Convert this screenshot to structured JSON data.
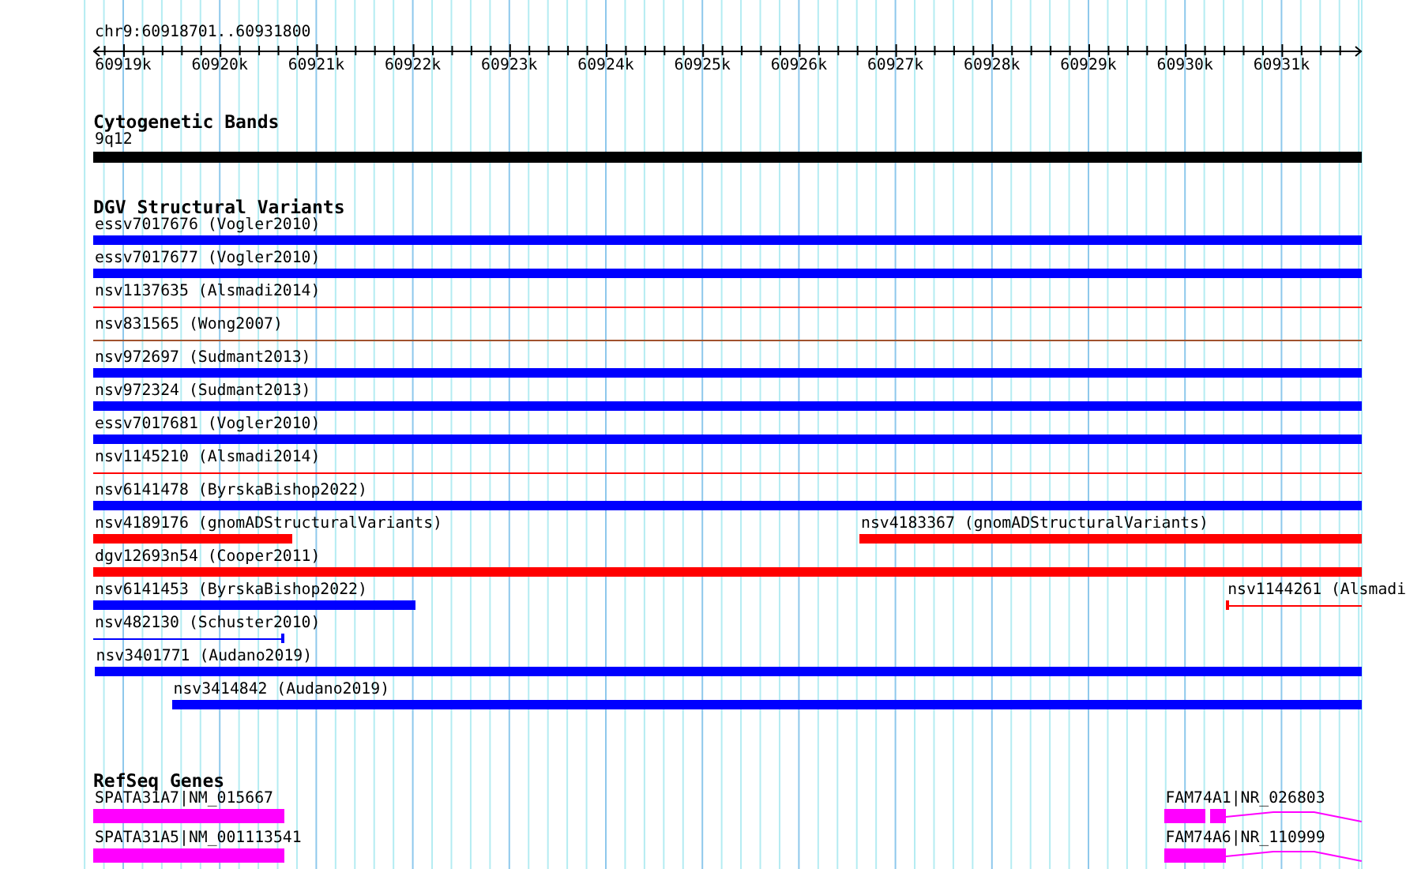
{
  "location": "chr9:60918701..60931800",
  "ruler": {
    "labels": [
      "60919k",
      "60920k",
      "60921k",
      "60922k",
      "60923k",
      "60924k",
      "60925k",
      "60926k",
      "60927k",
      "60928k",
      "60929k",
      "60930k",
      "60931k"
    ]
  },
  "tracks": [
    {
      "kind": "bands",
      "title": "Cytogenetic Bands",
      "rows": [
        {
          "features": [
            {
              "label": "9q12",
              "kind": "bar",
              "color": "#000000"
            }
          ]
        }
      ]
    },
    {
      "kind": "variants",
      "title": "DGV Structural Variants",
      "rows": [
        {
          "features": [
            {
              "label": "essv7017676 (Vogler2010)",
              "kind": "bar",
              "color": "#0000ff"
            }
          ]
        },
        {
          "features": [
            {
              "label": "essv7017677 (Vogler2010)",
              "kind": "bar",
              "color": "#0000ff"
            }
          ]
        },
        {
          "features": [
            {
              "label": "nsv1137635 (Alsmadi2014)",
              "kind": "line",
              "color": "#ff0000"
            }
          ]
        },
        {
          "features": [
            {
              "label": "nsv831565 (Wong2007)",
              "kind": "line",
              "color": "#a0522d"
            }
          ]
        },
        {
          "features": [
            {
              "label": "nsv972697 (Sudmant2013)",
              "kind": "bar",
              "color": "#0000ff"
            }
          ]
        },
        {
          "features": [
            {
              "label": "nsv972324 (Sudmant2013)",
              "kind": "bar",
              "color": "#0000ff"
            }
          ]
        },
        {
          "features": [
            {
              "label": "essv7017681 (Vogler2010)",
              "kind": "bar",
              "color": "#0000ff"
            }
          ]
        },
        {
          "features": [
            {
              "label": "nsv1145210 (Alsmadi2014)",
              "kind": "line",
              "color": "#ff0000"
            }
          ]
        },
        {
          "features": [
            {
              "label": "nsv6141478 (ByrskaBishop2022)",
              "kind": "bar",
              "color": "#0000ff"
            }
          ]
        },
        {
          "features": [
            {
              "label": "nsv4189176 (gnomADStructuralVariants)",
              "kind": "bar",
              "color": "#ff0000"
            },
            {
              "label": "nsv4183367 (gnomADStructuralVariants)",
              "kind": "bar",
              "color": "#ff0000"
            }
          ]
        },
        {
          "features": [
            {
              "label": "dgv12693n54 (Cooper2011)",
              "kind": "bar",
              "color": "#ff0000"
            }
          ]
        },
        {
          "features": [
            {
              "label": "nsv6141453 (ByrskaBishop2022)",
              "kind": "bar",
              "color": "#0000ff"
            },
            {
              "label": "nsv1144261 (Alsmadi",
              "kind": "line",
              "color": "#ff0000"
            }
          ]
        },
        {
          "features": [
            {
              "label": "nsv482130 (Schuster2010)",
              "kind": "line",
              "color": "#0000ff"
            }
          ]
        },
        {
          "features": [
            {
              "label": "nsv3401771 (Audano2019)",
              "kind": "bar",
              "color": "#0000ff"
            }
          ]
        },
        {
          "features": [
            {
              "label": "nsv3414842 (Audano2019)",
              "kind": "bar",
              "color": "#0000ff"
            }
          ]
        }
      ]
    },
    {
      "kind": "genes",
      "title": "RefSeq Genes",
      "rows": [
        {
          "features": [
            {
              "label": "SPATA31A7|NM_015667",
              "kind": "gene",
              "color": "#ff00ff"
            },
            {
              "label": "FAM74A1|NR_026803",
              "kind": "gene",
              "color": "#ff00ff"
            }
          ]
        },
        {
          "features": [
            {
              "label": "SPATA31A5|NM_001113541",
              "kind": "gene",
              "color": "#ff00ff"
            },
            {
              "label": "FAM74A6|NR_110999",
              "kind": "gene",
              "color": "#ff00ff"
            }
          ]
        }
      ]
    }
  ]
}
